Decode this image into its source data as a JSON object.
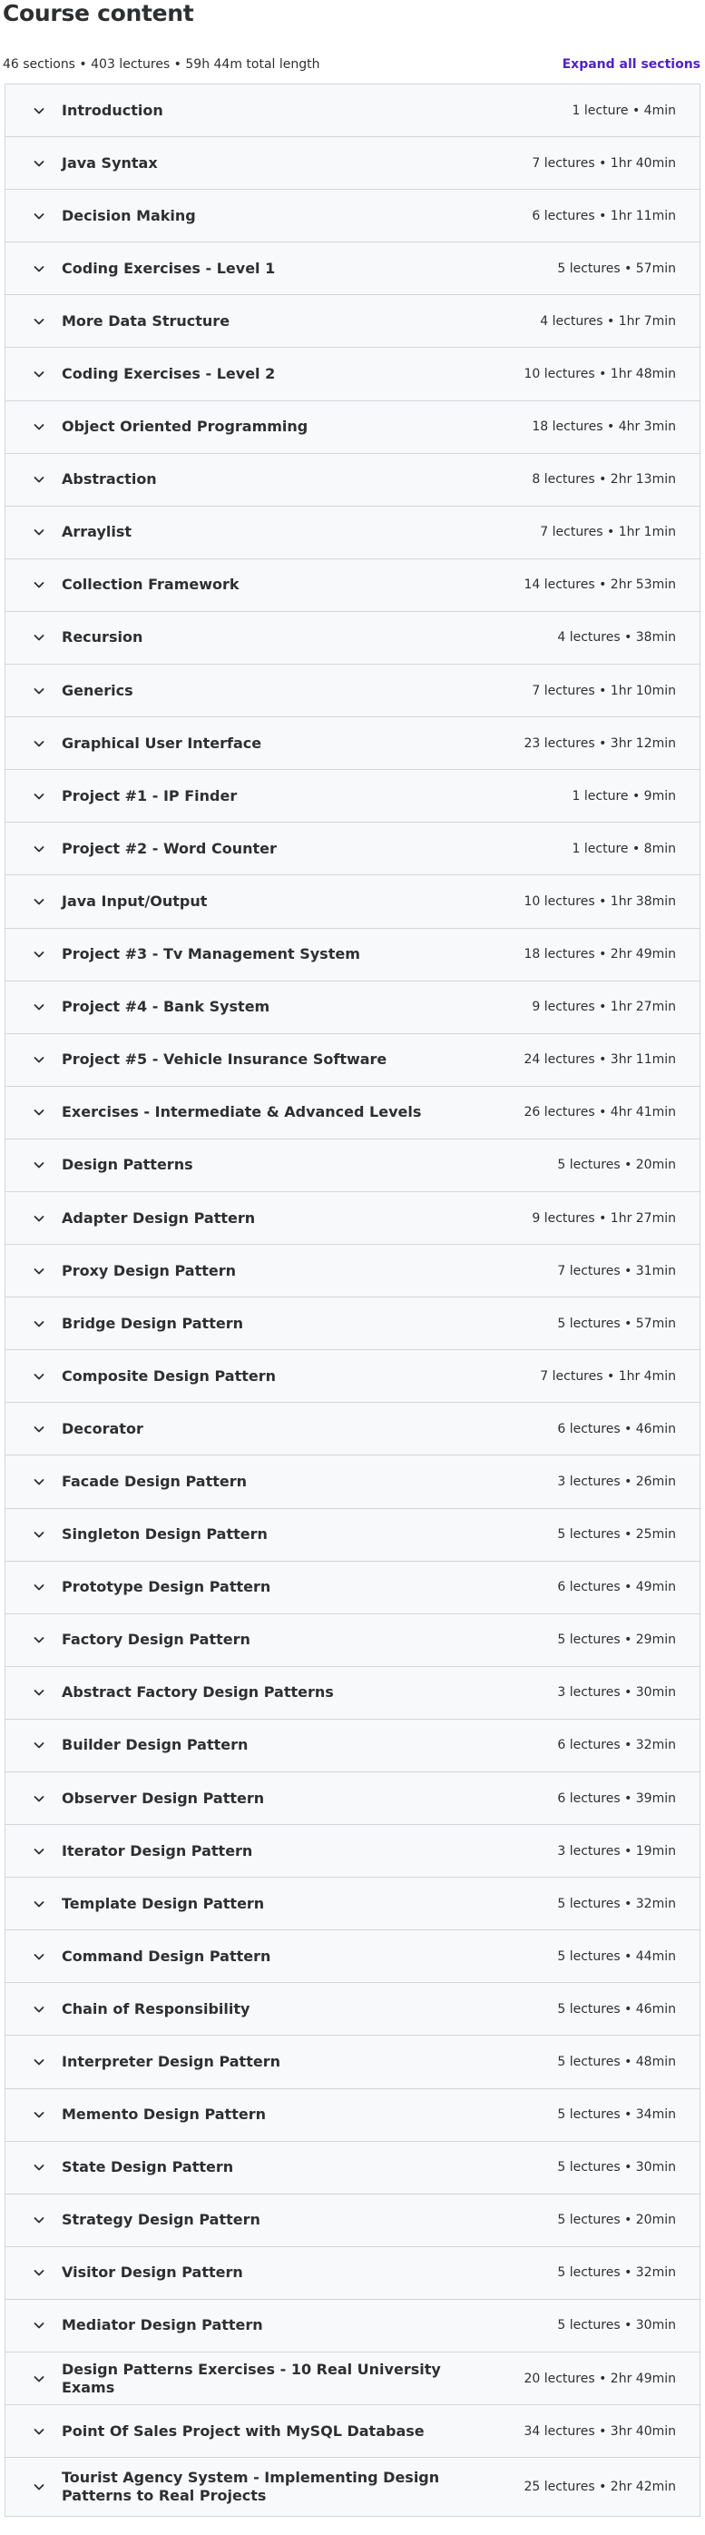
{
  "header": {
    "title": "Course content",
    "summary": "46 sections • 403 lectures • 59h 44m total length",
    "expand_all_label": "Expand all sections"
  },
  "icons": {
    "chevron": "chevron-down-icon"
  },
  "colors": {
    "accent": "#5022c3",
    "section_bg": "#f7f9fa",
    "border": "#d1d7dc",
    "text": "#2d2f31"
  },
  "sections": [
    {
      "title": "Introduction",
      "stats": "1 lecture • 4min"
    },
    {
      "title": "Java Syntax",
      "stats": "7 lectures • 1hr 40min"
    },
    {
      "title": "Decision Making",
      "stats": "6 lectures • 1hr 11min"
    },
    {
      "title": "Coding Exercises - Level 1",
      "stats": "5 lectures • 57min"
    },
    {
      "title": "More Data Structure",
      "stats": "4 lectures • 1hr 7min"
    },
    {
      "title": "Coding Exercises - Level 2",
      "stats": "10 lectures • 1hr 48min"
    },
    {
      "title": "Object Oriented Programming",
      "stats": "18 lectures • 4hr 3min"
    },
    {
      "title": "Abstraction",
      "stats": "8 lectures • 2hr 13min"
    },
    {
      "title": "Arraylist",
      "stats": "7 lectures • 1hr 1min"
    },
    {
      "title": "Collection Framework",
      "stats": "14 lectures • 2hr 53min"
    },
    {
      "title": "Recursion",
      "stats": "4 lectures • 38min"
    },
    {
      "title": "Generics",
      "stats": "7 lectures • 1hr 10min"
    },
    {
      "title": "Graphical User Interface",
      "stats": "23 lectures • 3hr 12min"
    },
    {
      "title": "Project #1 - IP Finder",
      "stats": "1 lecture • 9min"
    },
    {
      "title": "Project #2 - Word Counter",
      "stats": "1 lecture • 8min"
    },
    {
      "title": "Java Input/Output",
      "stats": "10 lectures • 1hr 38min"
    },
    {
      "title": "Project #3 - Tv Management System",
      "stats": "18 lectures • 2hr 49min"
    },
    {
      "title": "Project #4 - Bank System",
      "stats": "9 lectures • 1hr 27min"
    },
    {
      "title": "Project #5 - Vehicle Insurance Software",
      "stats": "24 lectures • 3hr 11min"
    },
    {
      "title": "Exercises - Intermediate & Advanced Levels",
      "stats": "26 lectures • 4hr 41min"
    },
    {
      "title": "Design Patterns",
      "stats": "5 lectures • 20min"
    },
    {
      "title": "Adapter Design Pattern",
      "stats": "9 lectures • 1hr 27min"
    },
    {
      "title": "Proxy Design Pattern",
      "stats": "7 lectures • 31min"
    },
    {
      "title": "Bridge Design Pattern",
      "stats": "5 lectures • 57min"
    },
    {
      "title": "Composite Design Pattern",
      "stats": "7 lectures • 1hr 4min"
    },
    {
      "title": "Decorator",
      "stats": "6 lectures • 46min"
    },
    {
      "title": "Facade Design Pattern",
      "stats": "3 lectures • 26min"
    },
    {
      "title": "Singleton Design Pattern",
      "stats": "5 lectures • 25min"
    },
    {
      "title": "Prototype Design Pattern",
      "stats": "6 lectures • 49min"
    },
    {
      "title": "Factory Design Pattern",
      "stats": "5 lectures • 29min"
    },
    {
      "title": "Abstract Factory Design Patterns",
      "stats": "3 lectures • 30min"
    },
    {
      "title": "Builder Design Pattern",
      "stats": "6 lectures • 32min"
    },
    {
      "title": "Observer Design Pattern",
      "stats": "6 lectures • 39min"
    },
    {
      "title": "Iterator Design Pattern",
      "stats": "3 lectures • 19min"
    },
    {
      "title": "Template Design Pattern",
      "stats": "5 lectures • 32min"
    },
    {
      "title": "Command Design Pattern",
      "stats": "5 lectures • 44min"
    },
    {
      "title": "Chain of Responsibility",
      "stats": "5 lectures • 46min"
    },
    {
      "title": "Interpreter Design Pattern",
      "stats": "5 lectures • 48min"
    },
    {
      "title": "Memento Design Pattern",
      "stats": "5 lectures • 34min"
    },
    {
      "title": "State Design Pattern",
      "stats": "5 lectures • 30min"
    },
    {
      "title": "Strategy Design Pattern",
      "stats": "5 lectures • 20min"
    },
    {
      "title": "Visitor Design Pattern",
      "stats": "5 lectures • 32min"
    },
    {
      "title": "Mediator Design Pattern",
      "stats": "5 lectures • 30min"
    },
    {
      "title": "Design Patterns Exercises - 10 Real University Exams",
      "stats": "20 lectures • 2hr 49min"
    },
    {
      "title": "Point Of Sales Project with MySQL Database",
      "stats": "34 lectures • 3hr 40min"
    },
    {
      "title": "Tourist Agency System - Implementing Design Patterns to Real Projects",
      "stats": "25 lectures • 2hr 42min"
    }
  ]
}
